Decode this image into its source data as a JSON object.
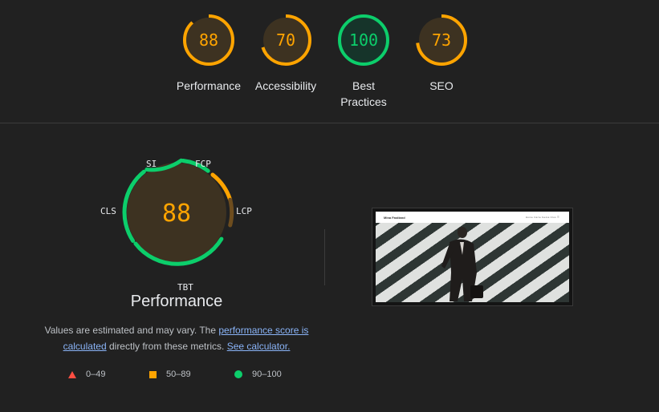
{
  "scores": [
    {
      "value": 88,
      "label": "Performance",
      "color": "#ffa400",
      "bg": "#3d3221",
      "fraction": 0.88
    },
    {
      "value": 70,
      "label": "Accessibility",
      "color": "#ffa400",
      "bg": "#3d3221",
      "fraction": 0.7
    },
    {
      "value": 100,
      "label": "Best\nPractices",
      "color": "#0cce6b",
      "bg": "#16342a",
      "fraction": 1.0
    },
    {
      "value": 73,
      "label": "SEO",
      "color": "#ffa400",
      "bg": "#3d3221",
      "fraction": 0.73
    }
  ],
  "performance": {
    "score": "88",
    "title": "Performance",
    "metrics": {
      "si": "SI",
      "fcp": "FCP",
      "lcp": "LCP",
      "tbt": "TBT",
      "cls": "CLS"
    },
    "metric_colors": {
      "SI": "#0cce6b",
      "FCP": "#0cce6b",
      "LCP": "#ffa400",
      "TBT": "#0cce6b",
      "CLS": "#0cce6b"
    }
  },
  "note": {
    "prefix": "Values are estimated and may vary. The ",
    "link1": "performance score is calculated",
    "middle": " directly from these metrics. ",
    "link2": "See calculator."
  },
  "legend": [
    {
      "range": "0–49",
      "icon": "red-triangle-icon",
      "color": "#ff4e42"
    },
    {
      "range": "50–89",
      "icon": "orange-square-icon",
      "color": "#ffa400"
    },
    {
      "range": "90–100",
      "icon": "green-circle-icon",
      "color": "#0cce6b"
    }
  ],
  "thumbnail": {
    "site_name": "Mina Fastland",
    "nav": "Home  Carte  Gema  Clos  ☰"
  },
  "colors": {
    "background": "#212121",
    "pass": "#0cce6b",
    "average": "#ffa400",
    "fail": "#ff4e42",
    "link": "#8ab4f8"
  }
}
